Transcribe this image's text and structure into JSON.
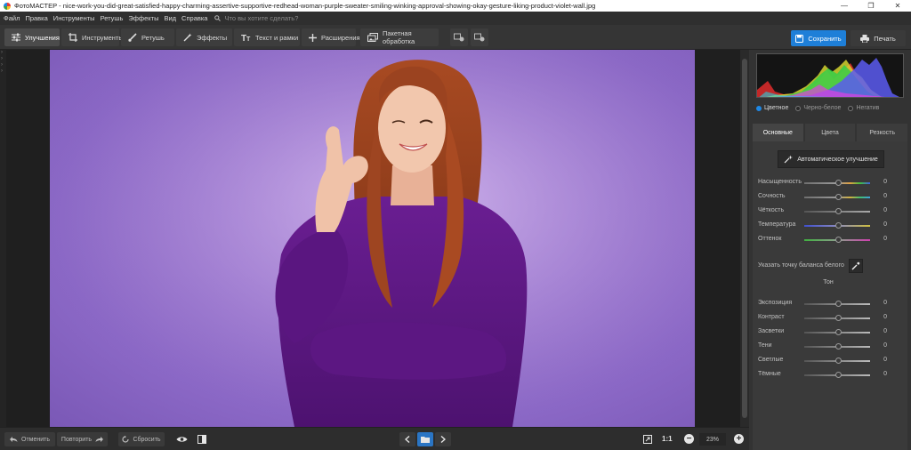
{
  "window": {
    "title": "ФотоМАСТЕР - nice-work-you-did-great-satisfied-happy-charming-assertive-supportive-redhead-woman-purple-sweater-smiling-winking-approval-showing-okay-gesture-liking-product-violet-wall.jpg",
    "minimize": "—",
    "restore": "❐",
    "close": "✕"
  },
  "menu": {
    "items": [
      "Файл",
      "Правка",
      "Инструменты",
      "Ретушь",
      "Эффекты",
      "Вид",
      "Справка"
    ],
    "search_placeholder": "Что вы хотите сделать?"
  },
  "toolbar": {
    "tabs": [
      {
        "label": "Улучшения",
        "icon": "sliders-icon",
        "active": true
      },
      {
        "label": "Инструменты",
        "icon": "crop-icon",
        "active": false
      },
      {
        "label": "Ретушь",
        "icon": "brush-icon",
        "active": false
      },
      {
        "label": "Эффекты",
        "icon": "magic-wand-icon",
        "active": false
      },
      {
        "label": "Текст и рамки",
        "icon": "text-icon",
        "active": false
      },
      {
        "label": "Расширения",
        "icon": "plus-icon",
        "active": false
      },
      {
        "label": "Пакетная обработка",
        "icon": "batch-icon",
        "active": false
      }
    ],
    "save_label": "Сохранить",
    "print_label": "Печать",
    "accent": "#1e7fd8"
  },
  "panel": {
    "color_modes": [
      {
        "label": "Цветное",
        "selected": true
      },
      {
        "label": "Черно-белое",
        "selected": false
      },
      {
        "label": "Негатив",
        "selected": false
      }
    ],
    "tabs": [
      {
        "label": "Основные",
        "active": true
      },
      {
        "label": "Цвета",
        "active": false
      },
      {
        "label": "Резкость",
        "active": false
      }
    ],
    "auto_button": "Автоматическое улучшение",
    "basic_sliders": [
      {
        "label": "Насыщенность",
        "value": "0"
      },
      {
        "label": "Сочность",
        "value": "0"
      },
      {
        "label": "Чёткость",
        "value": "0"
      },
      {
        "label": "Температура",
        "value": "0"
      },
      {
        "label": "Оттенок",
        "value": "0"
      }
    ],
    "white_balance_label": "Указать точку баланса белого",
    "tone_section": "Тон",
    "tone_sliders": [
      {
        "label": "Экспозиция",
        "value": "0"
      },
      {
        "label": "Контраст",
        "value": "0"
      },
      {
        "label": "Засветки",
        "value": "0"
      },
      {
        "label": "Тени",
        "value": "0"
      },
      {
        "label": "Светлые",
        "value": "0"
      },
      {
        "label": "Тёмные",
        "value": "0"
      }
    ]
  },
  "bottom": {
    "undo_label": "Отменить",
    "redo_label": "Повторить",
    "reset_label": "Сбросить",
    "ratio_label": "1:1",
    "zoom_value": "23%",
    "zoom_out": "−",
    "zoom_in": "+"
  }
}
